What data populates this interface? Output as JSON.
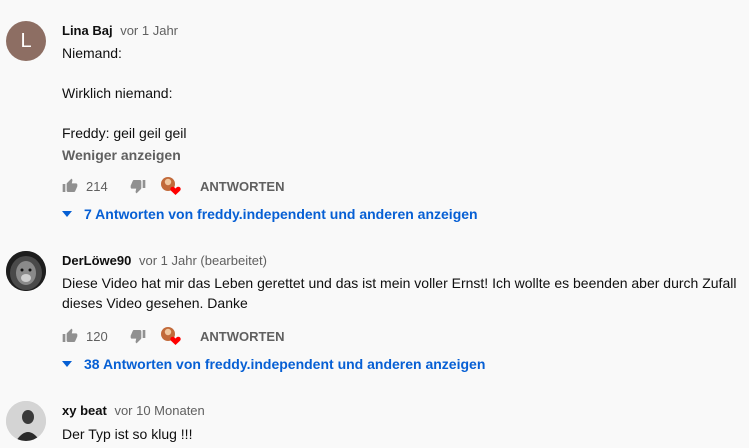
{
  "comments": [
    {
      "author": "Lina Baj",
      "time": "vor 1 Jahr",
      "avatar_letter": "L",
      "avatar_color": "#8d6e63",
      "lines": [
        "Niemand:",
        "Wirklich niemand:",
        "Freddy: geil geil geil"
      ],
      "show_less": "Weniger anzeigen",
      "likes": "214",
      "reply_label": "ANTWORTEN",
      "replies_toggle": "7 Antworten von freddy.independent und anderen anzeigen"
    },
    {
      "author": "DerLöwe90",
      "time": "vor 1 Jahr (bearbeitet)",
      "lines": [
        "Diese Video hat mir das Leben gerettet und das ist mein voller Ernst! Ich wollte es beenden aber durch Zufall",
        "dieses Video gesehen. Danke"
      ],
      "likes": "120",
      "reply_label": "ANTWORTEN",
      "replies_toggle": "38 Antworten von freddy.independent und anderen anzeigen"
    },
    {
      "author": "xy beat",
      "time": "vor 10 Monaten",
      "lines": [
        "Der Typ ist so klug !!!"
      ]
    }
  ],
  "colors": {
    "background": "#f9f9f9",
    "link": "#065fd4",
    "secondary_text": "#606060",
    "heart": "#ff0000"
  },
  "icons": [
    "thumb-up-icon",
    "thumb-down-icon",
    "creator-heart-icon",
    "caret-down-icon"
  ]
}
